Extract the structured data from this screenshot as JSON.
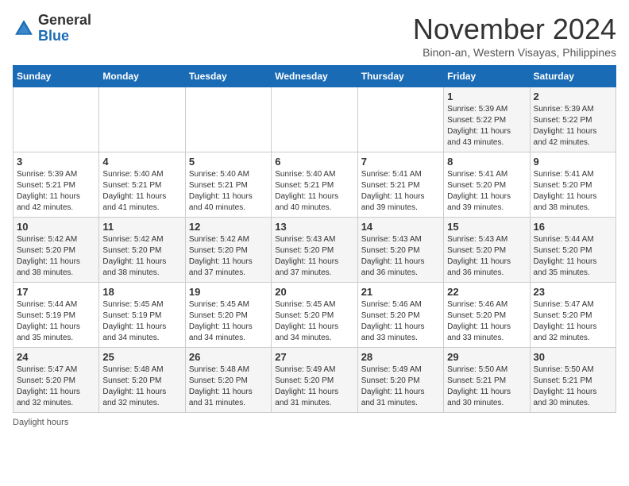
{
  "header": {
    "logo_general": "General",
    "logo_blue": "Blue",
    "month_title": "November 2024",
    "subtitle": "Binon-an, Western Visayas, Philippines"
  },
  "days_of_week": [
    "Sunday",
    "Monday",
    "Tuesday",
    "Wednesday",
    "Thursday",
    "Friday",
    "Saturday"
  ],
  "footer": {
    "daylight_label": "Daylight hours"
  },
  "weeks": [
    [
      {
        "day": "",
        "info": ""
      },
      {
        "day": "",
        "info": ""
      },
      {
        "day": "",
        "info": ""
      },
      {
        "day": "",
        "info": ""
      },
      {
        "day": "",
        "info": ""
      },
      {
        "day": "1",
        "info": "Sunrise: 5:39 AM\nSunset: 5:22 PM\nDaylight: 11 hours\nand 43 minutes."
      },
      {
        "day": "2",
        "info": "Sunrise: 5:39 AM\nSunset: 5:22 PM\nDaylight: 11 hours\nand 42 minutes."
      }
    ],
    [
      {
        "day": "3",
        "info": "Sunrise: 5:39 AM\nSunset: 5:21 PM\nDaylight: 11 hours\nand 42 minutes."
      },
      {
        "day": "4",
        "info": "Sunrise: 5:40 AM\nSunset: 5:21 PM\nDaylight: 11 hours\nand 41 minutes."
      },
      {
        "day": "5",
        "info": "Sunrise: 5:40 AM\nSunset: 5:21 PM\nDaylight: 11 hours\nand 40 minutes."
      },
      {
        "day": "6",
        "info": "Sunrise: 5:40 AM\nSunset: 5:21 PM\nDaylight: 11 hours\nand 40 minutes."
      },
      {
        "day": "7",
        "info": "Sunrise: 5:41 AM\nSunset: 5:21 PM\nDaylight: 11 hours\nand 39 minutes."
      },
      {
        "day": "8",
        "info": "Sunrise: 5:41 AM\nSunset: 5:20 PM\nDaylight: 11 hours\nand 39 minutes."
      },
      {
        "day": "9",
        "info": "Sunrise: 5:41 AM\nSunset: 5:20 PM\nDaylight: 11 hours\nand 38 minutes."
      }
    ],
    [
      {
        "day": "10",
        "info": "Sunrise: 5:42 AM\nSunset: 5:20 PM\nDaylight: 11 hours\nand 38 minutes."
      },
      {
        "day": "11",
        "info": "Sunrise: 5:42 AM\nSunset: 5:20 PM\nDaylight: 11 hours\nand 38 minutes."
      },
      {
        "day": "12",
        "info": "Sunrise: 5:42 AM\nSunset: 5:20 PM\nDaylight: 11 hours\nand 37 minutes."
      },
      {
        "day": "13",
        "info": "Sunrise: 5:43 AM\nSunset: 5:20 PM\nDaylight: 11 hours\nand 37 minutes."
      },
      {
        "day": "14",
        "info": "Sunrise: 5:43 AM\nSunset: 5:20 PM\nDaylight: 11 hours\nand 36 minutes."
      },
      {
        "day": "15",
        "info": "Sunrise: 5:43 AM\nSunset: 5:20 PM\nDaylight: 11 hours\nand 36 minutes."
      },
      {
        "day": "16",
        "info": "Sunrise: 5:44 AM\nSunset: 5:20 PM\nDaylight: 11 hours\nand 35 minutes."
      }
    ],
    [
      {
        "day": "17",
        "info": "Sunrise: 5:44 AM\nSunset: 5:19 PM\nDaylight: 11 hours\nand 35 minutes."
      },
      {
        "day": "18",
        "info": "Sunrise: 5:45 AM\nSunset: 5:19 PM\nDaylight: 11 hours\nand 34 minutes."
      },
      {
        "day": "19",
        "info": "Sunrise: 5:45 AM\nSunset: 5:20 PM\nDaylight: 11 hours\nand 34 minutes."
      },
      {
        "day": "20",
        "info": "Sunrise: 5:45 AM\nSunset: 5:20 PM\nDaylight: 11 hours\nand 34 minutes."
      },
      {
        "day": "21",
        "info": "Sunrise: 5:46 AM\nSunset: 5:20 PM\nDaylight: 11 hours\nand 33 minutes."
      },
      {
        "day": "22",
        "info": "Sunrise: 5:46 AM\nSunset: 5:20 PM\nDaylight: 11 hours\nand 33 minutes."
      },
      {
        "day": "23",
        "info": "Sunrise: 5:47 AM\nSunset: 5:20 PM\nDaylight: 11 hours\nand 32 minutes."
      }
    ],
    [
      {
        "day": "24",
        "info": "Sunrise: 5:47 AM\nSunset: 5:20 PM\nDaylight: 11 hours\nand 32 minutes."
      },
      {
        "day": "25",
        "info": "Sunrise: 5:48 AM\nSunset: 5:20 PM\nDaylight: 11 hours\nand 32 minutes."
      },
      {
        "day": "26",
        "info": "Sunrise: 5:48 AM\nSunset: 5:20 PM\nDaylight: 11 hours\nand 31 minutes."
      },
      {
        "day": "27",
        "info": "Sunrise: 5:49 AM\nSunset: 5:20 PM\nDaylight: 11 hours\nand 31 minutes."
      },
      {
        "day": "28",
        "info": "Sunrise: 5:49 AM\nSunset: 5:20 PM\nDaylight: 11 hours\nand 31 minutes."
      },
      {
        "day": "29",
        "info": "Sunrise: 5:50 AM\nSunset: 5:21 PM\nDaylight: 11 hours\nand 30 minutes."
      },
      {
        "day": "30",
        "info": "Sunrise: 5:50 AM\nSunset: 5:21 PM\nDaylight: 11 hours\nand 30 minutes."
      }
    ]
  ]
}
